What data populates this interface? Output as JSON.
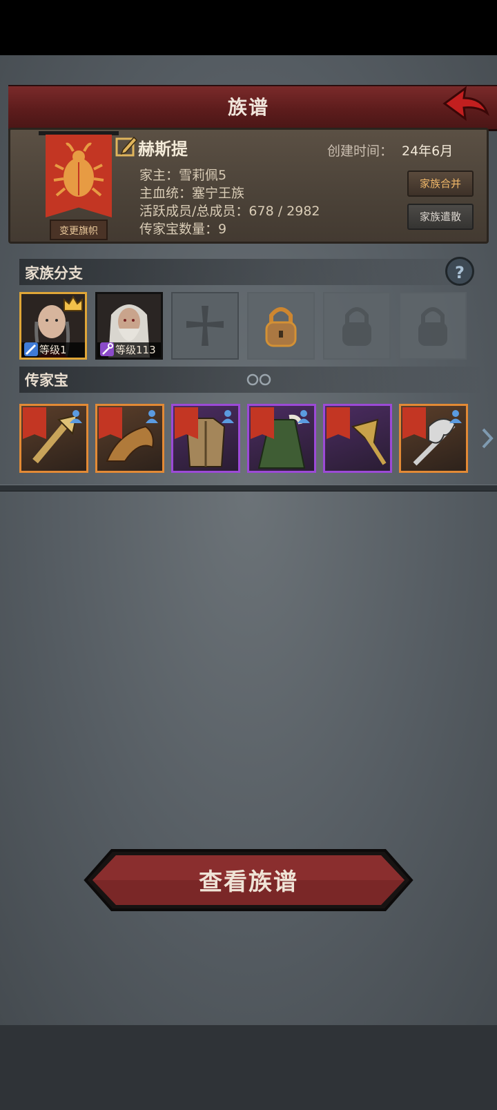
{
  "header": {
    "title": "族谱"
  },
  "family": {
    "name": "赫斯提",
    "change_flag": "变更旗帜",
    "created_label": "创建时间：",
    "created_value": "24年6月",
    "head_line": "家主：雪莉佩5",
    "bloodline_line": "主血统：塞宁王族",
    "members_line": "活跃成员/总成员：678 / 2982",
    "heirloom_count_line": "传家宝数量：9",
    "merge_button": "家族合并",
    "disband_button": "家族遣散"
  },
  "branches": {
    "title": "家族分支",
    "help_icon": "?",
    "members": [
      {
        "level_label": "等级1",
        "class_icon": "sword-class-icon",
        "class_color": "#3f7bd6",
        "frame_color": "#e0a637",
        "crown": true
      },
      {
        "level_label": "等级113",
        "class_icon": "staff-class-icon",
        "class_color": "#8b4bc9",
        "frame_color": "#111111",
        "crown": false
      }
    ],
    "slots": [
      "empty-slot",
      "unlockable-slot",
      "locked-slot",
      "locked-slot"
    ]
  },
  "heirlooms": {
    "title": "传家宝",
    "items": [
      {
        "name": "mace-heirloom",
        "rarity": "orange",
        "equipped": true
      },
      {
        "name": "dragon-heirloom",
        "rarity": "orange",
        "equipped": true
      },
      {
        "name": "armor-heirloom",
        "rarity": "purple",
        "equipped": true
      },
      {
        "name": "cloak-heirloom",
        "rarity": "purple",
        "equipped": true
      },
      {
        "name": "scepter-heirloom",
        "rarity": "purple",
        "equipped": false
      },
      {
        "name": "axe-heirloom",
        "rarity": "orange",
        "equipped": true
      }
    ]
  },
  "actions": {
    "view_tree": "查看族谱"
  },
  "colors": {
    "header_red": "#6b2222",
    "banner_red": "#c33623",
    "accent_gold": "#e0a637",
    "legendary_orange": "#e38a35",
    "epic_purple": "#9c4ad7"
  }
}
